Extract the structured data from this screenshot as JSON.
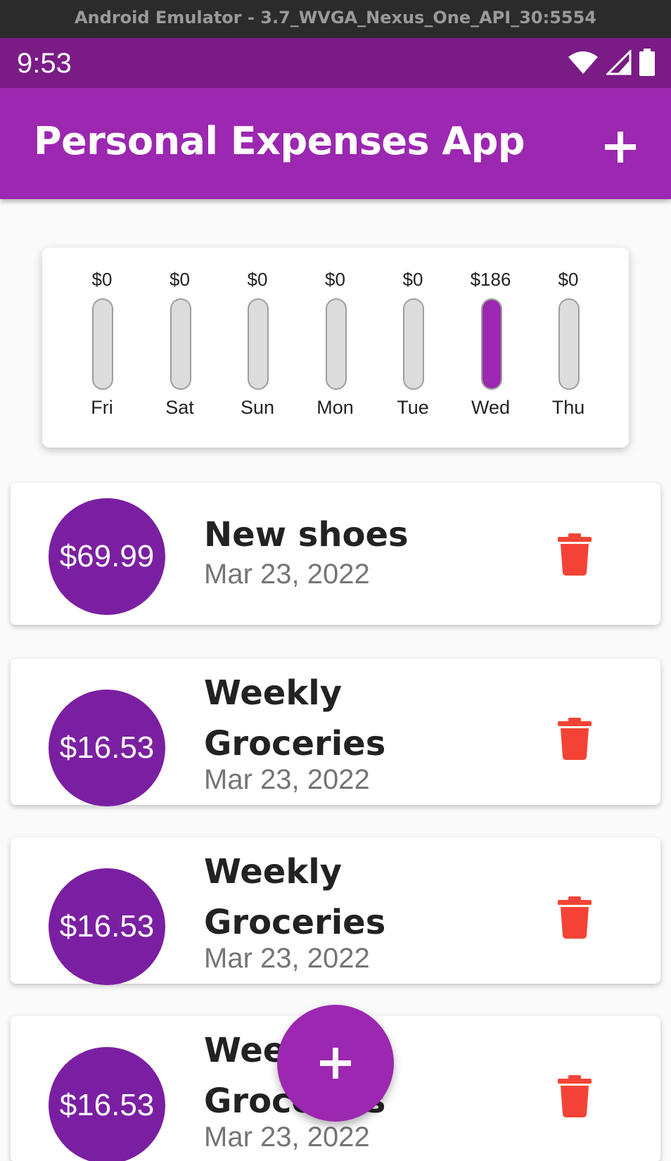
{
  "window": {
    "title": "Android Emulator - 3.7_WVGA_Nexus_One_API_30:5554"
  },
  "status_bar": {
    "time": "9:53",
    "icons": [
      "wifi-icon",
      "signal-icon",
      "battery-icon"
    ]
  },
  "app_bar": {
    "title": "Personal Expenses App",
    "action_icon": "plus-icon"
  },
  "colors": {
    "primary": "#9c27b0",
    "primary_dark": "#7a1b86",
    "accent_circle": "#7b1fa2",
    "delete": "#f44336",
    "bar_empty": "#dcdcdc"
  },
  "chart": {
    "bars": [
      {
        "day": "Fri",
        "amount": "$0",
        "fraction": 0
      },
      {
        "day": "Sat",
        "amount": "$0",
        "fraction": 0
      },
      {
        "day": "Sun",
        "amount": "$0",
        "fraction": 0
      },
      {
        "day": "Mon",
        "amount": "$0",
        "fraction": 0
      },
      {
        "day": "Tue",
        "amount": "$0",
        "fraction": 0
      },
      {
        "day": "Wed",
        "amount": "$186",
        "fraction": 1
      },
      {
        "day": "Thu",
        "amount": "$0",
        "fraction": 0
      }
    ]
  },
  "transactions": [
    {
      "amount": "$69.99",
      "title": "New shoes",
      "date": "Mar 23, 2022",
      "delete_icon": "trash-icon"
    },
    {
      "amount": "$16.53",
      "title": "Weekly Groceries",
      "date": "Mar 23, 2022",
      "delete_icon": "trash-icon"
    },
    {
      "amount": "$16.53",
      "title": "Weekly Groceries",
      "date": "Mar 23, 2022",
      "delete_icon": "trash-icon"
    },
    {
      "amount": "$16.53",
      "title": "Weekly Groceries",
      "date": "Mar 23, 2022",
      "delete_icon": "trash-icon"
    }
  ],
  "fab": {
    "icon": "plus-icon"
  }
}
